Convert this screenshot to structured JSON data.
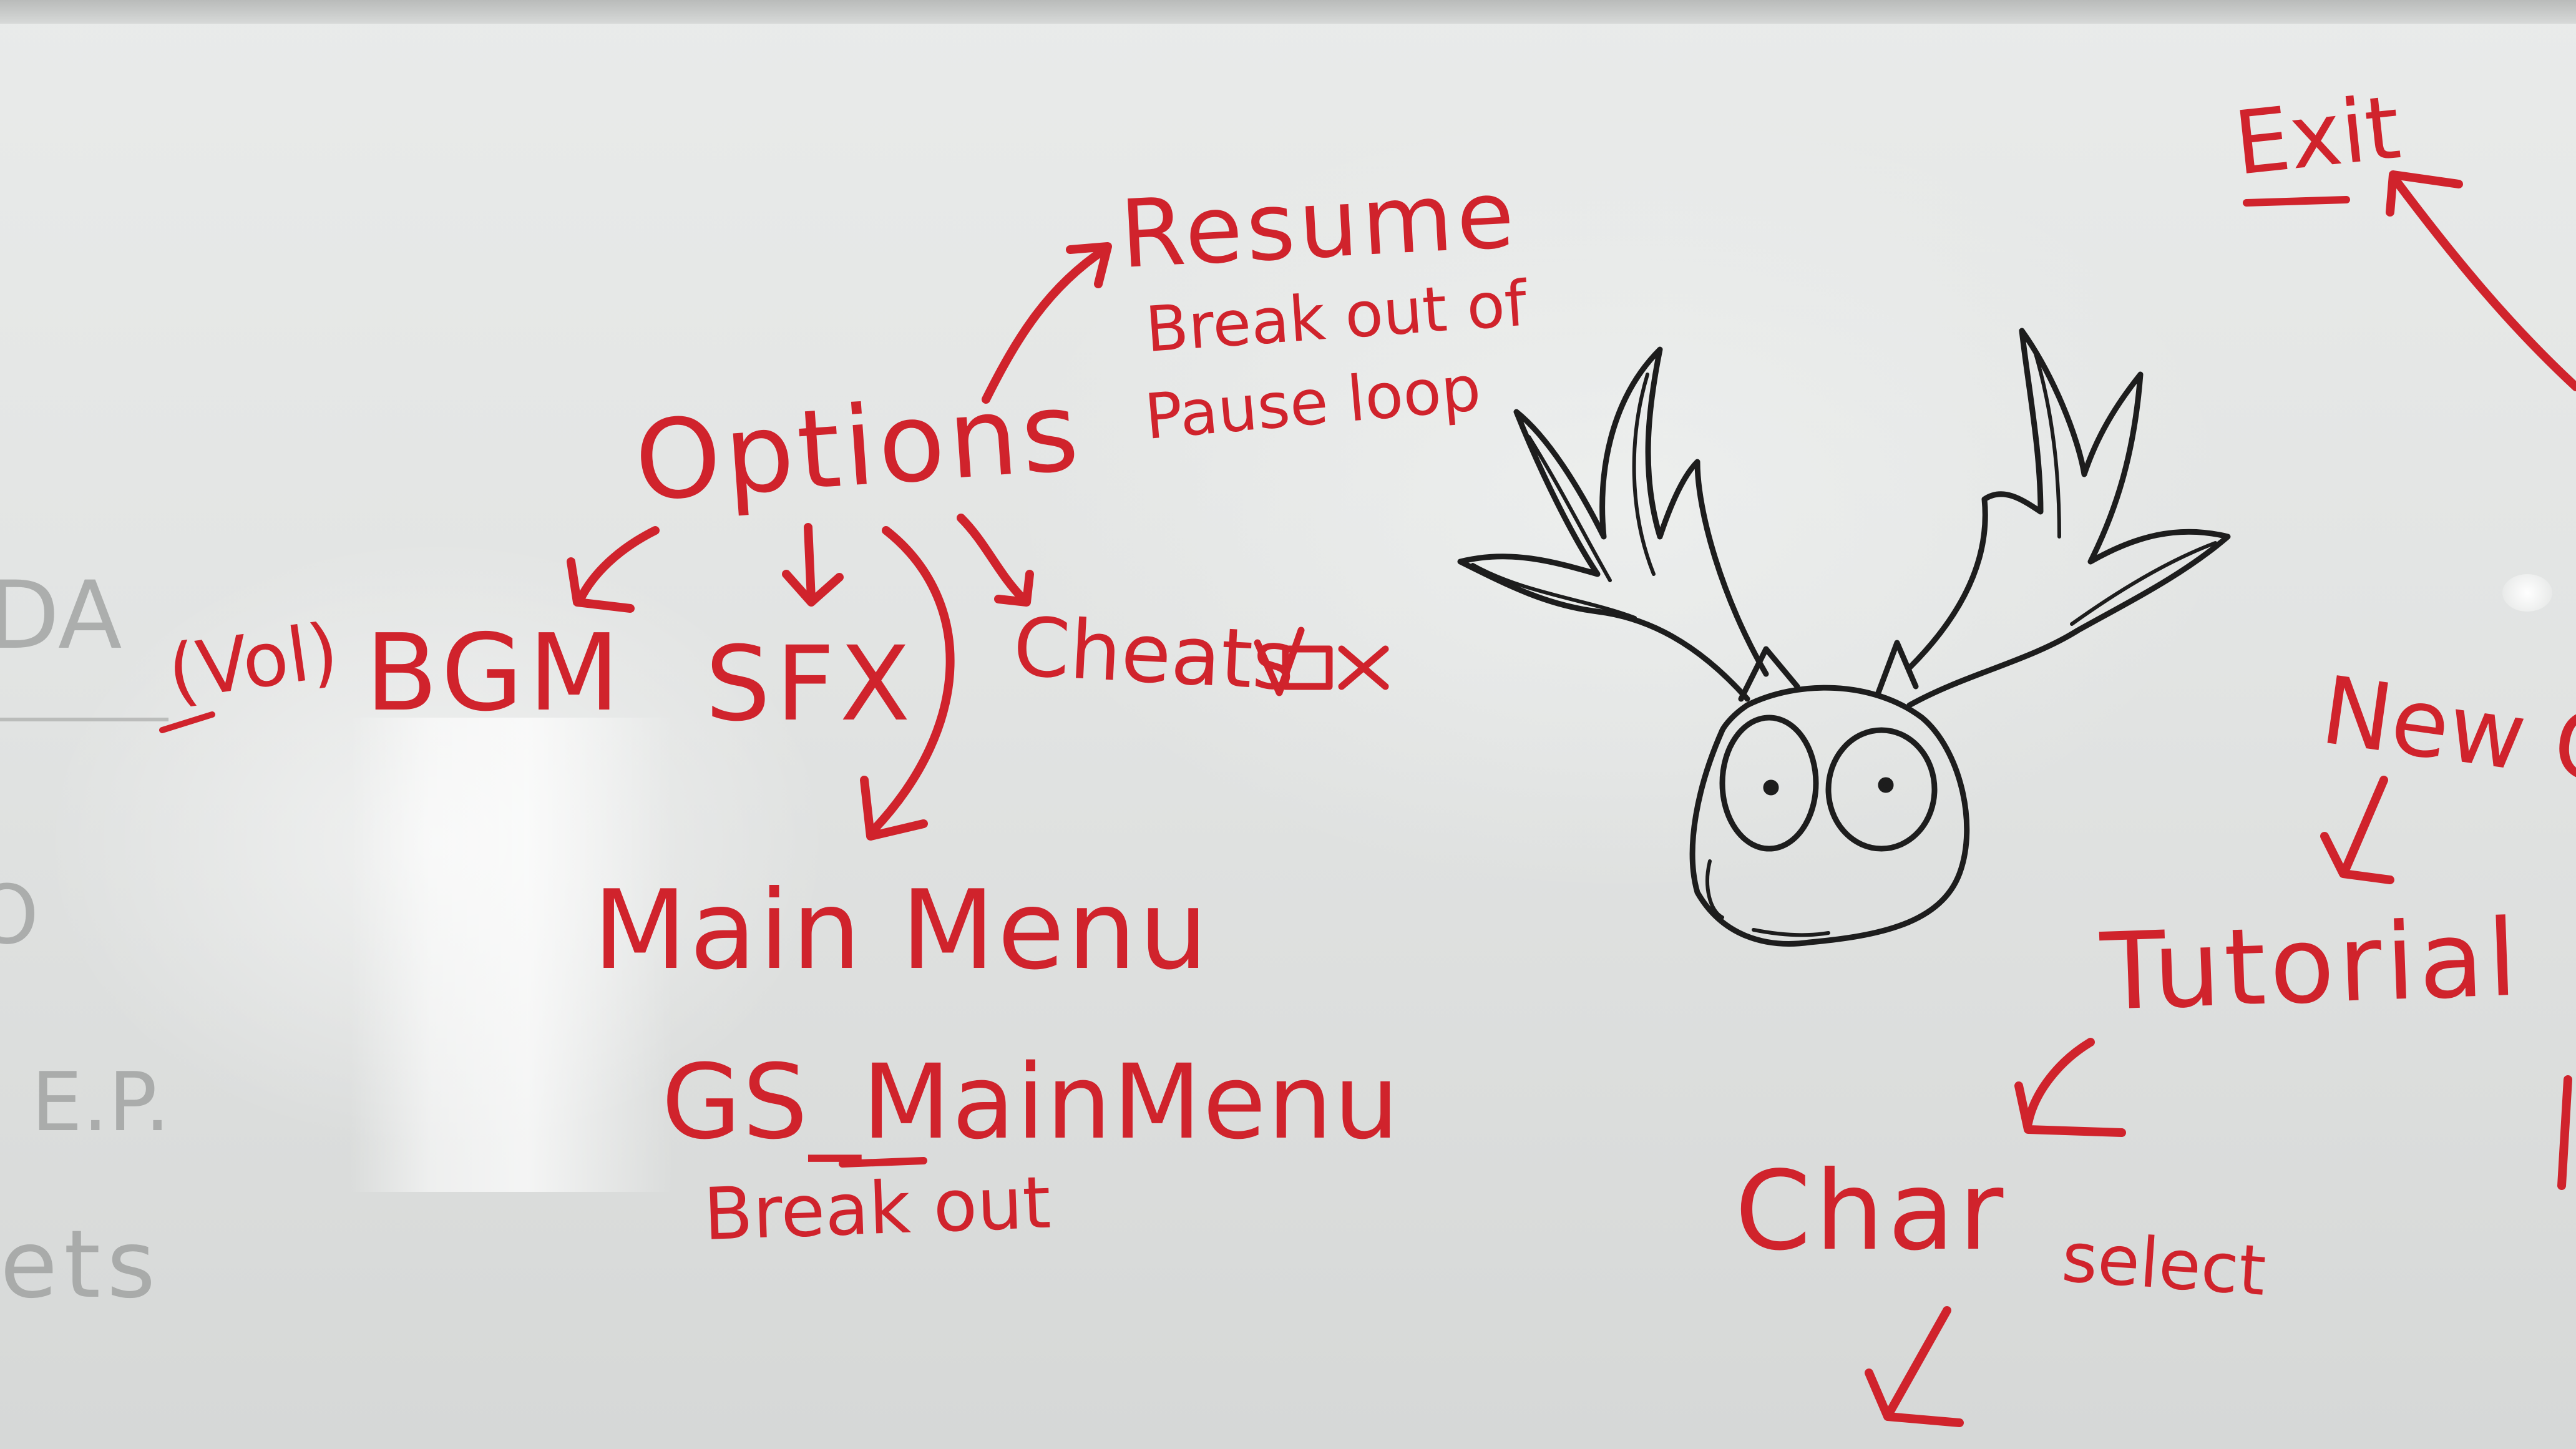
{
  "whiteboard": {
    "ink_color": "#d0232c",
    "board_color": "#e6e8e7",
    "notes": {
      "resume": "Resume",
      "resume_note_line1": "Break out of",
      "resume_note_line2": "Pause loop",
      "options": "Options",
      "vol": "(Vol)",
      "bgm": "BGM",
      "sfx": "SFX",
      "cheats": "Cheats",
      "main_menu": "Main Menu",
      "gs_main_menu": "GS_MainMenu",
      "break_out": "Break out",
      "exit": "Exit",
      "new_game": "New G",
      "tutorial": "Tutorial",
      "char": "Char",
      "select": "select"
    },
    "faded_text": {
      "line1": "DA",
      "line2": "O",
      "line3": "E.P.",
      "line4": "ets"
    },
    "drawing": {
      "subject": "moose-head-doodle"
    }
  }
}
